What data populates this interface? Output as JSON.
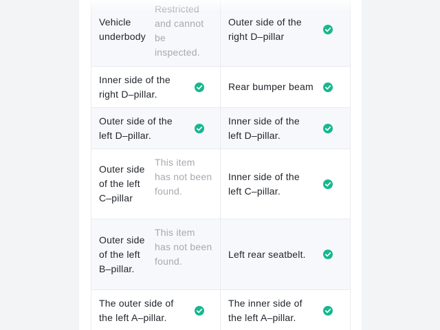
{
  "colors": {
    "check": "#17b890",
    "text": "#1f2329",
    "muted": "#a6a9b0"
  },
  "rows": [
    {
      "left": {
        "label": "Vehicle underbody",
        "note": "Restricted and cannot be inspected."
      },
      "right": {
        "label": "Outer side of the right D–pillar",
        "status": "check-circle-icon"
      }
    },
    {
      "left": {
        "label": "Inner side of the right D–pillar.",
        "status": "check-circle-icon"
      },
      "right": {
        "label": "Rear bumper beam",
        "status": "check-circle-icon"
      }
    },
    {
      "left": {
        "label": "Outer side of the left D–pillar.",
        "status": "check-circle-icon"
      },
      "right": {
        "label": "Inner side of the left D–pillar.",
        "status": "check-circle-icon"
      }
    },
    {
      "left": {
        "label": "Outer side of the left C–pillar",
        "note": "This item has not been found."
      },
      "right": {
        "label": "Inner side of the left C–pillar.",
        "status": "check-circle-icon"
      }
    },
    {
      "left": {
        "label": "Outer side of the left B–pillar.",
        "note": "This item has not been found."
      },
      "right": {
        "label": "Left rear seatbelt.",
        "status": "check-circle-icon"
      }
    },
    {
      "left": {
        "label": "The outer side of the left A–pillar.",
        "status": "check-circle-icon"
      },
      "right": {
        "label": "The inner side of the left A–pillar.",
        "status": "check-circle-icon"
      }
    }
  ]
}
